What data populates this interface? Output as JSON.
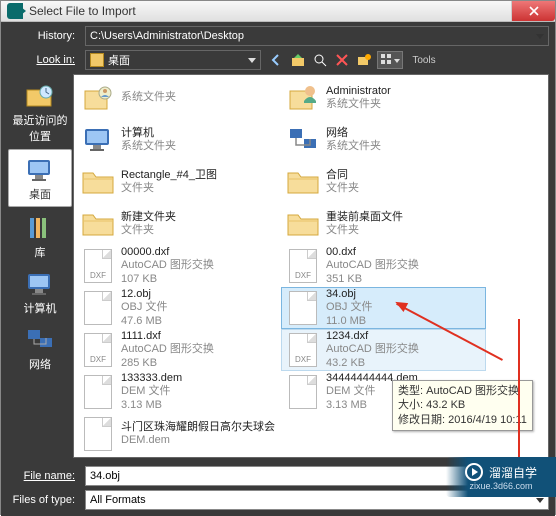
{
  "window": {
    "title": "Select File to Import"
  },
  "labels": {
    "history": "History:",
    "lookin": "Look in:",
    "filename": "File name:",
    "filetype": "Files of type:"
  },
  "history_path": "C:\\Users\\Administrator\\Desktop",
  "lookin_value": "桌面",
  "sidebar": [
    {
      "key": "recent",
      "label": "最近访问的位置"
    },
    {
      "key": "desktop",
      "label": "桌面"
    },
    {
      "key": "lib",
      "label": "库"
    },
    {
      "key": "computer",
      "label": "计算机"
    },
    {
      "key": "network",
      "label": "网络"
    }
  ],
  "col1": [
    {
      "name": "",
      "type": "系统文件夹",
      "icon": "user"
    },
    {
      "name": "计算机",
      "type": "系统文件夹",
      "icon": "computer"
    },
    {
      "name": "Rectangle_#4_卫图",
      "type": "文件夹",
      "icon": "folder"
    },
    {
      "name": "新建文件夹",
      "type": "文件夹",
      "icon": "folder"
    },
    {
      "name": "00000.dxf",
      "type": "AutoCAD 图形交换",
      "size": "107 KB",
      "icon": "dxf"
    },
    {
      "name": "12.obj",
      "type": "OBJ 文件",
      "size": "47.6 MB",
      "icon": "blank"
    },
    {
      "name": "1111.dxf",
      "type": "AutoCAD 图形交换",
      "size": "285 KB",
      "icon": "dxf"
    },
    {
      "name": "133333.dem",
      "type": "DEM 文件",
      "size": "3.13 MB",
      "icon": "blank"
    },
    {
      "name": "斗门区珠海耀朗假日高尔夫球会",
      "type": "DEM.dem",
      "icon": "blank"
    }
  ],
  "col2": [
    {
      "name": "Administrator",
      "type": "系统文件夹",
      "icon": "admin"
    },
    {
      "name": "网络",
      "type": "系统文件夹",
      "icon": "network"
    },
    {
      "name": "合同",
      "type": "文件夹",
      "icon": "folder"
    },
    {
      "name": "重装前桌面文件",
      "type": "文件夹",
      "icon": "folder"
    },
    {
      "name": "00.dxf",
      "type": "AutoCAD 图形交换",
      "size": "351 KB",
      "icon": "dxf"
    },
    {
      "name": "34.obj",
      "type": "OBJ 文件",
      "size": "11.0 MB",
      "icon": "blank",
      "sel": true
    },
    {
      "name": "1234.dxf",
      "type": "AutoCAD 图形交换",
      "size": "43.2 KB",
      "icon": "dxf",
      "hov": true
    },
    {
      "name": "34444444444.dem",
      "type": "DEM 文件",
      "size": "3.13 MB",
      "icon": "blank"
    }
  ],
  "tooltip": {
    "l1": "类型: AutoCAD 图形交换",
    "l2": "大小: 43.2 KB",
    "l3": "修改日期: 2016/4/19 10:11"
  },
  "filename_value": "34.obj",
  "filetype_value": "All Formats",
  "watermark": {
    "brand": "溜溜自学",
    "url": "zixue.3d66.com"
  }
}
